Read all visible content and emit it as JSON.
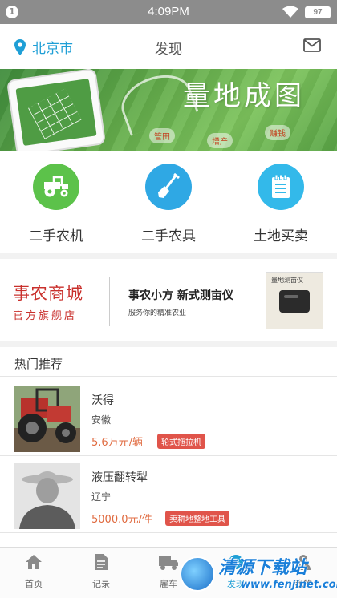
{
  "status_bar": {
    "notification_count": "1",
    "time": "4:09PM",
    "battery": "97"
  },
  "header": {
    "city": "北京市",
    "title": "发现"
  },
  "banner": {
    "brand": "量地成图",
    "tags": [
      "管田",
      "增产",
      "赚钱"
    ]
  },
  "categories": [
    {
      "label": "二手农机",
      "icon": "tractor-icon",
      "color": "#5cc24a"
    },
    {
      "label": "二手农具",
      "icon": "shovel-icon",
      "color": "#2fa8e4"
    },
    {
      "label": "土地买卖",
      "icon": "document-icon",
      "color": "#33b9ea"
    }
  ],
  "promo": {
    "shop_name": "事农商城",
    "shop_subtitle": "官方旗舰店",
    "headline": "事农小方   新式测亩仪",
    "tagline": "服务你的精准农业",
    "product_title": "量地测亩仪"
  },
  "hot": {
    "title": "热门推荐",
    "items": [
      {
        "name": "沃得",
        "region": "安徽",
        "price": "5.6万元/辆",
        "badge": "轮式拖拉机"
      },
      {
        "name": "液压翻转犁",
        "region": "辽宁",
        "price": "5000.0元/件",
        "badge": "卖耕地整地工具"
      }
    ]
  },
  "bottom_nav": [
    {
      "label": "首页",
      "icon": "home-icon"
    },
    {
      "label": "记录",
      "icon": "record-icon"
    },
    {
      "label": "雇车",
      "icon": "truck-icon"
    },
    {
      "label": "发现",
      "icon": "discover-icon"
    },
    {
      "label": "我的",
      "icon": "user-icon"
    }
  ],
  "watermark": {
    "text": "清源下载站",
    "url": "www.fenjinet.com"
  },
  "colors": {
    "accent": "#1f9fd6",
    "price": "#e06a3f",
    "badge": "#e0544a",
    "shop": "#c9302c"
  }
}
